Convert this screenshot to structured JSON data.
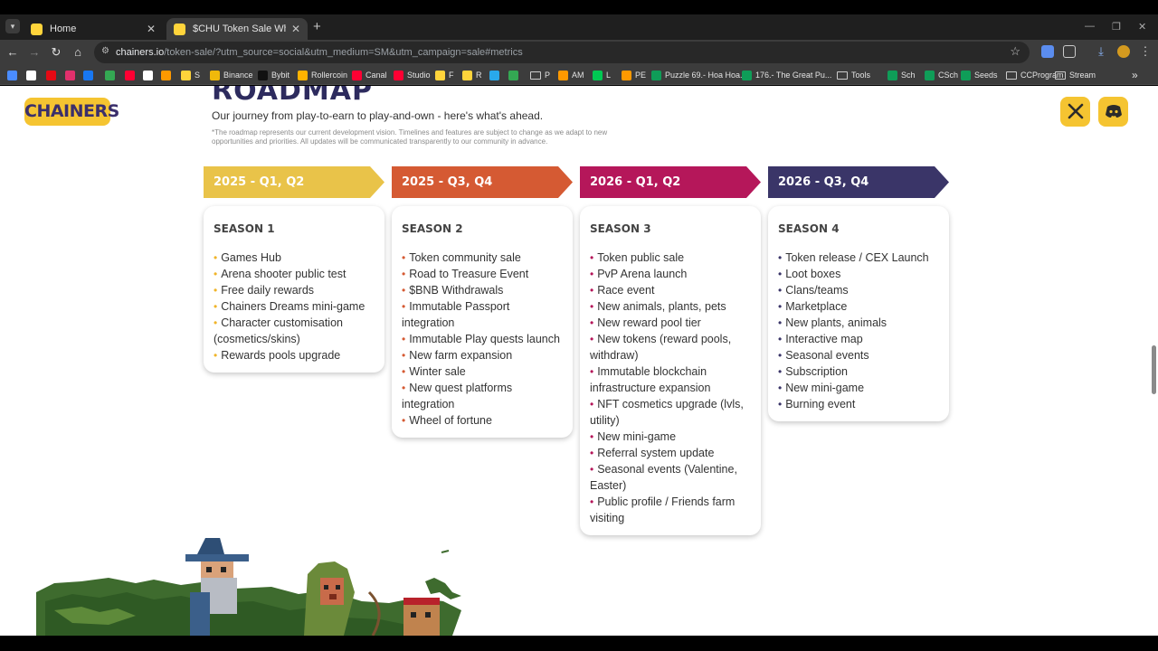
{
  "browser": {
    "tabs": [
      {
        "title": "Home"
      },
      {
        "title": "$CHU Token Sale Whitelist | Ch"
      }
    ],
    "url": {
      "host": "chainers.io",
      "path": "/token-sale/?utm_source=social&utm_medium=SM&utm_campaign=sale#metrics"
    },
    "bookmarks": [
      {
        "label": "",
        "color": "#4a8cff"
      },
      {
        "label": "",
        "color": "#ffffff"
      },
      {
        "label": "",
        "color": "#e50914"
      },
      {
        "label": "",
        "color": "#e1306c"
      },
      {
        "label": "",
        "color": "#1877f2"
      },
      {
        "label": "",
        "color": "#34a853"
      },
      {
        "label": "",
        "color": "#ff0033"
      },
      {
        "label": "",
        "color": "#ffffff"
      },
      {
        "label": "",
        "color": "#ff9900"
      },
      {
        "label": "S",
        "color": "#ffd43b"
      },
      {
        "label": "Binance",
        "color": "#f0b90b"
      },
      {
        "label": "Bybit",
        "color": "#111111"
      },
      {
        "label": "Rollercoin",
        "color": "#ffb300"
      },
      {
        "label": "Canal",
        "color": "#ff0033"
      },
      {
        "label": "Studio",
        "color": "#ff0033"
      },
      {
        "label": "F",
        "color": "#ffd43b"
      },
      {
        "label": "R",
        "color": "#ffd43b"
      },
      {
        "label": "",
        "color": "#29a9eb"
      },
      {
        "label": "",
        "color": "#34a853"
      },
      {
        "label": "P",
        "color": "folder"
      },
      {
        "label": "AM",
        "color": "#ff9900"
      },
      {
        "label": "L",
        "color": "#00c853"
      },
      {
        "label": "PE",
        "color": "#ff9900"
      },
      {
        "label": "Puzzle 69.- Hoa Hoa...",
        "color": "#0f9d58"
      },
      {
        "label": "176.- The Great Pu...",
        "color": "#0f9d58"
      },
      {
        "label": "Tools",
        "color": "folder"
      },
      {
        "label": "Sch",
        "color": "#0f9d58"
      },
      {
        "label": "CSch",
        "color": "#0f9d58"
      },
      {
        "label": "Seeds",
        "color": "#0f9d58"
      },
      {
        "label": "CCProgram",
        "color": "folder"
      },
      {
        "label": "Stream",
        "color": "folder"
      }
    ]
  },
  "header": {
    "logo_text": "CHAINERS",
    "social": [
      "x-icon",
      "discord-icon"
    ]
  },
  "roadmap": {
    "title": "ROADMAP",
    "subtitle": "Our journey from play-to-earn to play-and-own - here's what's ahead.",
    "disclaimer": "*The roadmap represents our current development vision. Timelines and features are subject to change as we adapt to new opportunities and priorities. All updates will be communicated transparently to our community in advance.",
    "phases": [
      {
        "label": "2025 - Q1, Q2",
        "color": "#e9c349",
        "dot_color": "#f0b429",
        "season": "SEASON 1",
        "items": [
          "Games Hub",
          "Arena shooter public test",
          "Free daily rewards",
          "Chainers Dreams mini-game",
          "Character customisation (cosmetics/skins)",
          "Rewards pools upgrade"
        ]
      },
      {
        "label": "2025 - Q3, Q4",
        "color": "#d55a33",
        "dot_color": "#d55a33",
        "season": "SEASON 2",
        "items": [
          "Token community sale",
          "Road to Treasure Event",
          "$BNB Withdrawals",
          "Immutable Passport integration",
          "Immutable Play quests launch",
          "New farm expansion",
          "Winter sale",
          "New quest platforms integration",
          "Wheel of fortune"
        ]
      },
      {
        "label": "2026 - Q1, Q2",
        "color": "#b5175a",
        "dot_color": "#b5175a",
        "season": "SEASON 3",
        "items": [
          "Token public sale",
          "PvP Arena launch",
          "Race event",
          "New animals, plants, pets",
          "New reward pool tier",
          "New tokens (reward pools, withdraw)",
          "Immutable blockchain infrastructure expansion",
          "NFT cosmetics upgrade (lvls, utility)",
          "New mini-game",
          "Referral system update",
          "Seasonal events (Valentine, Easter)",
          "Public profile / Friends farm visiting"
        ]
      },
      {
        "label": "2026 - Q3, Q4",
        "color": "#3a3568",
        "dot_color": "#3a3568",
        "season": "SEASON 4",
        "items": [
          "Token release / CEX Launch",
          "Loot boxes",
          "Clans/teams",
          "Marketplace",
          "New plants, animals",
          "Interactive map",
          "Seasonal events",
          "Subscription",
          "New mini-game",
          "Burning event"
        ]
      }
    ]
  }
}
